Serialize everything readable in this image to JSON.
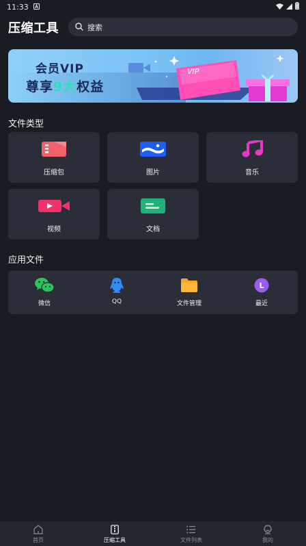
{
  "status_bar": {
    "time": "11:33",
    "icons": [
      "notification-a-icon",
      "wifi-icon",
      "signal-icon",
      "battery-icon"
    ]
  },
  "header": {
    "title": "压缩工具",
    "search": {
      "placeholder": "搜索",
      "icon": "search-icon"
    }
  },
  "banner": {
    "line1": "会员VIP",
    "line2_prefix": "尊享",
    "line2_highlight": "9大",
    "line2_suffix": "权益",
    "art_text": "VIP"
  },
  "file_types": {
    "title": "文件类型",
    "items": [
      {
        "label": "压缩包",
        "icon": "zip-icon",
        "color": "#f2606a"
      },
      {
        "label": "图片",
        "icon": "image-icon",
        "color": "#1e5ef5"
      },
      {
        "label": "音乐",
        "icon": "music-icon",
        "color": "#e23ac6"
      },
      {
        "label": "视频",
        "icon": "video-icon",
        "color": "#f0326a"
      },
      {
        "label": "文档",
        "icon": "document-icon",
        "color": "#1fb27a"
      }
    ]
  },
  "app_files": {
    "title": "应用文件",
    "items": [
      {
        "label": "微信",
        "icon": "wechat-icon",
        "color": "#2bc45c"
      },
      {
        "label": "QQ",
        "icon": "qq-icon",
        "color": "#2f8cf5"
      },
      {
        "label": "文件管理",
        "icon": "folder-icon",
        "color": "#f5a623"
      },
      {
        "label": "最近",
        "icon": "recent-icon",
        "color": "#9b5cf0",
        "glyph": "L"
      }
    ]
  },
  "bottom_nav": {
    "items": [
      {
        "label": "首页",
        "icon": "home-icon"
      },
      {
        "label": "压缩工具",
        "icon": "zip-tool-icon",
        "active": true
      },
      {
        "label": "文件列表",
        "icon": "list-icon"
      },
      {
        "label": "我的",
        "icon": "profile-icon"
      }
    ]
  },
  "colors": {
    "background": "#1a1c23",
    "card": "#2b2e38",
    "search_bg": "#2c2f3a",
    "nav_bg": "#23262e",
    "banner_accent": "#2be0b8"
  }
}
